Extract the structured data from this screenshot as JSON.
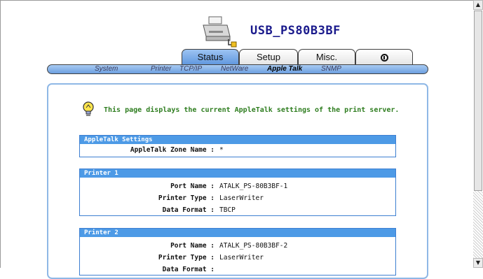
{
  "header": {
    "device_name": "USB_PS80B3BF"
  },
  "tabs": [
    {
      "label": "Status",
      "active": true
    },
    {
      "label": "Setup",
      "active": false
    },
    {
      "label": "Misc.",
      "active": false
    },
    {
      "icon": "info-icon",
      "active": false
    }
  ],
  "subnav": [
    {
      "label": "System",
      "active": false
    },
    {
      "label": "Printer",
      "active": false
    },
    {
      "label": "TCP/IP",
      "active": false
    },
    {
      "label": "NetWare",
      "active": false
    },
    {
      "label": "Apple Talk",
      "active": true
    },
    {
      "label": "SNMP",
      "active": false
    }
  ],
  "intro": {
    "icon": "lightbulb-icon",
    "text": "This page displays the current AppleTalk settings of the print server."
  },
  "sections": [
    {
      "title": "AppleTalk Settings",
      "rows": [
        {
          "label": "AppleTalk Zone Name :",
          "value": "*"
        }
      ]
    },
    {
      "title": "Printer 1",
      "rows": [
        {
          "label": "Port Name :",
          "value": "ATALK_PS-80B3BF-1"
        },
        {
          "label": "Printer Type :",
          "value": "LaserWriter"
        },
        {
          "label": "Data Format :",
          "value": "TBCP"
        }
      ]
    },
    {
      "title": "Printer 2",
      "rows": [
        {
          "label": "Port Name :",
          "value": "ATALK_PS-80B3BF-2"
        },
        {
          "label": "Printer Type :",
          "value": "LaserWriter"
        },
        {
          "label": "Data Format :",
          "value": ""
        }
      ]
    }
  ],
  "colors": {
    "accent_blue": "#4d9ae6",
    "intro_green": "#2e7d1f",
    "device_name_navy": "#1a1a8c"
  }
}
